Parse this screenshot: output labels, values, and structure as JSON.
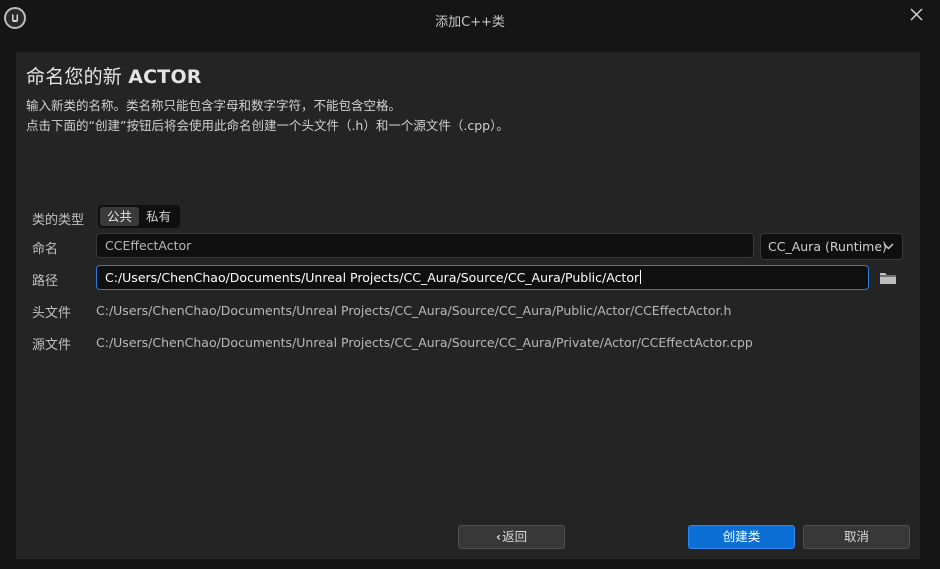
{
  "window": {
    "title": "添加C++类"
  },
  "header": {
    "title_prefix": "命名您的新 ",
    "title_class": "ACTOR",
    "description_line1": "输入新类的名称。类名称只能包含字母和数字字符，不能包含空格。",
    "description_line2": "点击下面的“创建”按钮后将会使用此命名创建一个头文件（.h）和一个源文件（.cpp）。"
  },
  "form": {
    "class_type_label": "类的类型",
    "class_type_options": [
      "公共",
      "私有"
    ],
    "class_type_selected": "公共",
    "name_label": "命名",
    "name_value": "CCEffectActor",
    "module_value": "CC_Aura (Runtime)",
    "path_label": "路径",
    "path_value": "C:/Users/ChenChao/Documents/Unreal Projects/CC_Aura/Source/CC_Aura/Public/Actor",
    "header_file_label": "头文件",
    "header_file_value": "C:/Users/ChenChao/Documents/Unreal Projects/CC_Aura/Source/CC_Aura/Public/Actor/CCEffectActor.h",
    "source_file_label": "源文件",
    "source_file_value": "C:/Users/ChenChao/Documents/Unreal Projects/CC_Aura/Source/CC_Aura/Private/Actor/CCEffectActor.cpp"
  },
  "footer": {
    "back_label": "返回",
    "create_label": "创建类",
    "cancel_label": "取消"
  },
  "icons": {
    "logo": "unreal-engine-logo",
    "close": "close-icon",
    "chevron": "chevron-down-icon",
    "folder": "folder-icon",
    "back_arrow": "chevron-left-icon"
  },
  "colors": {
    "accent": "#0b6fd6",
    "focus_border": "#2a7de0",
    "panel": "#242424",
    "background": "#151515"
  }
}
